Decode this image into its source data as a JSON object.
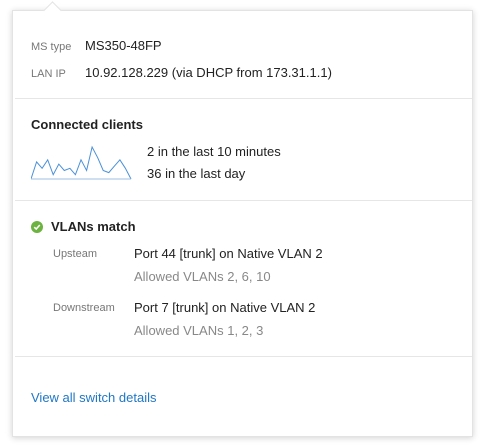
{
  "device": {
    "ms_type_label": "MS type",
    "ms_type_value": "MS350-48FP",
    "lan_ip_label": "LAN IP",
    "lan_ip_value": "10.92.128.229 (via DHCP from 173.31.1.1)"
  },
  "clients": {
    "title": "Connected clients",
    "last_10_minutes": "2 in the last 10 minutes",
    "last_day": "36 in the last day",
    "sparkline_color": "#4a90d9",
    "sparkline_values": [
      0,
      8,
      5,
      9,
      2,
      7,
      4,
      5,
      2,
      9,
      4,
      15,
      10,
      4,
      3,
      6,
      9,
      5,
      0
    ]
  },
  "vlans": {
    "status_icon": "check-circle-icon",
    "status_color": "#6cb33f",
    "title": "VLANs match",
    "upstream_label": "Upsteam",
    "upstream_port": "Port 44 [trunk] on Native VLAN 2",
    "upstream_allowed": "Allowed VLANs 2, 6, 10",
    "downstream_label": "Downstream",
    "downstream_port": "Port 7 [trunk] on Native VLAN 2",
    "downstream_allowed": "Allowed VLANs 1, 2, 3"
  },
  "footer": {
    "link_label": "View all switch details",
    "link_color": "#1f77c6"
  }
}
